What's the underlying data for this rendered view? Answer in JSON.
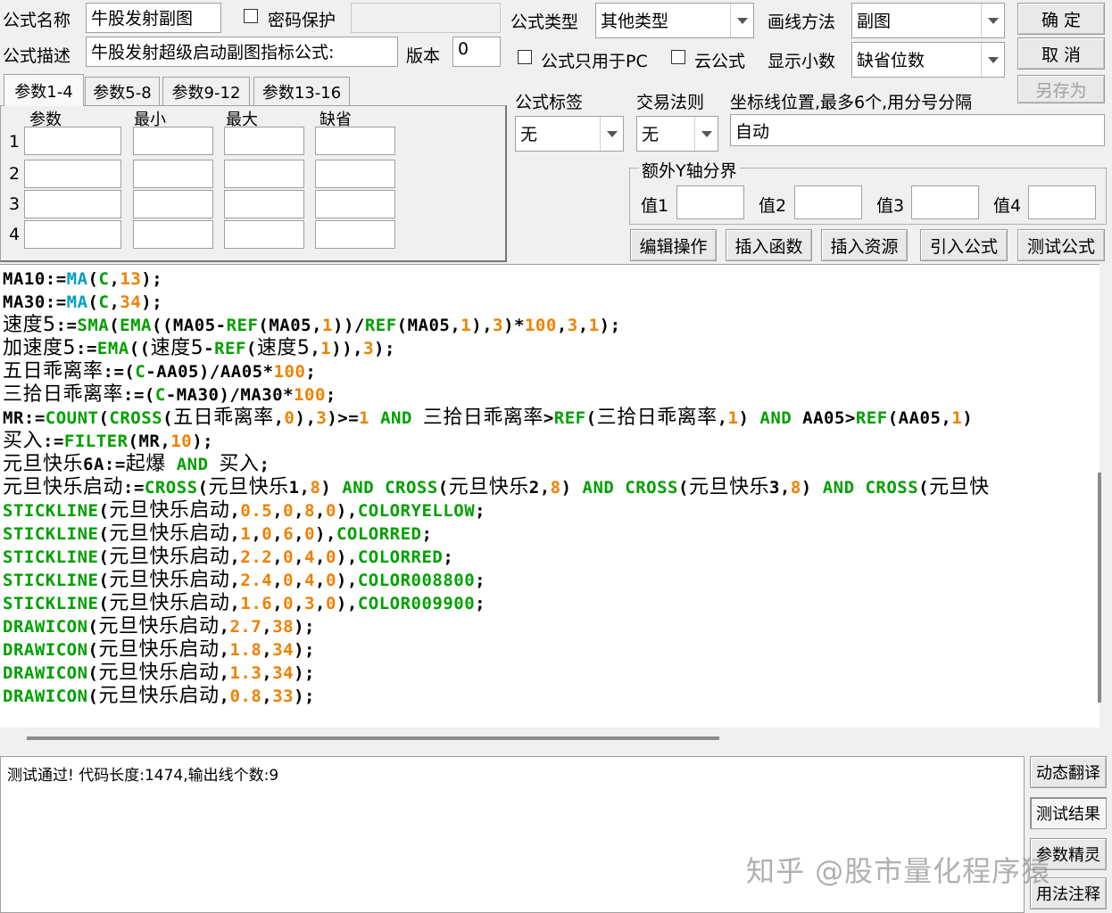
{
  "form": {
    "name_label": "公式名称",
    "name_value": "牛股发射副图",
    "password_label": "密码保护",
    "desc_label": "公式描述",
    "desc_value": "牛股发射超级启动副图指标公式:",
    "version_label": "版本",
    "version_value": "0",
    "type_label": "公式类型",
    "type_value": "其他类型",
    "draw_label": "画线方法",
    "draw_value": "副图",
    "pc_only_label": "公式只用于PC",
    "cloud_label": "云公式",
    "decimals_label": "显示小数",
    "decimals_value": "缺省位数",
    "tag_label": "公式标签",
    "tag_value": "无",
    "rule_label": "交易法则",
    "rule_value": "无",
    "axis_label": "坐标线位置,最多6个,用分号分隔",
    "axis_value": "自动",
    "yaxis_group": "额外Y轴分界",
    "yaxis_values": [
      "值1",
      "值2",
      "值3",
      "值4"
    ]
  },
  "buttons": {
    "ok": "确 定",
    "cancel": "取 消",
    "save_as": "另存为",
    "edit": "编辑操作",
    "insert_func": "插入函数",
    "insert_res": "插入资源",
    "import": "引入公式",
    "test": "测试公式",
    "dyn_translate": "动态翻译",
    "test_result": "测试结果",
    "param_wizard": "参数精灵",
    "usage_notes": "用法注释"
  },
  "tabs": [
    "参数1-4",
    "参数5-8",
    "参数9-12",
    "参数13-16"
  ],
  "params": {
    "headers": [
      "参数",
      "最小",
      "最大",
      "缺省"
    ],
    "rows": [
      "1",
      "2",
      "3",
      "4"
    ]
  },
  "colors": {
    "keyword": "#00a000",
    "number": "#f08000",
    "function": "#00a0c0",
    "plain": "#000000"
  },
  "code": [
    [
      [
        "MA10:=",
        "p"
      ],
      [
        "MA",
        "f"
      ],
      [
        "(",
        "p"
      ],
      [
        "C",
        "k"
      ],
      [
        ",",
        "p"
      ],
      [
        "13",
        "n"
      ],
      [
        ");",
        "p"
      ]
    ],
    [
      [
        "MA30:=",
        "p"
      ],
      [
        "MA",
        "f"
      ],
      [
        "(",
        "p"
      ],
      [
        "C",
        "k"
      ],
      [
        ",",
        "p"
      ],
      [
        "34",
        "n"
      ],
      [
        ");",
        "p"
      ]
    ],
    [
      [
        "速度5",
        "c"
      ],
      [
        ":=",
        "p"
      ],
      [
        "SMA",
        "k"
      ],
      [
        "(",
        "p"
      ],
      [
        "EMA",
        "k"
      ],
      [
        "((MA05-",
        "p"
      ],
      [
        "REF",
        "k"
      ],
      [
        "(MA05,",
        "p"
      ],
      [
        "1",
        "n"
      ],
      [
        "))/",
        "p"
      ],
      [
        "REF",
        "k"
      ],
      [
        "(MA05,",
        "p"
      ],
      [
        "1",
        "n"
      ],
      [
        "),",
        "p"
      ],
      [
        "3",
        "n"
      ],
      [
        ")*",
        "p"
      ],
      [
        "100",
        "n"
      ],
      [
        ",",
        "p"
      ],
      [
        "3",
        "n"
      ],
      [
        ",",
        "p"
      ],
      [
        "1",
        "n"
      ],
      [
        ");",
        "p"
      ]
    ],
    [
      [
        "加速度5",
        "c"
      ],
      [
        ":=",
        "p"
      ],
      [
        "EMA",
        "k"
      ],
      [
        "((",
        "p"
      ],
      [
        "速度5",
        "c"
      ],
      [
        "-",
        "p"
      ],
      [
        "REF",
        "k"
      ],
      [
        "(",
        "p"
      ],
      [
        "速度5",
        "c"
      ],
      [
        ",",
        "p"
      ],
      [
        "1",
        "n"
      ],
      [
        ")),",
        "p"
      ],
      [
        "3",
        "n"
      ],
      [
        ");",
        "p"
      ]
    ],
    [
      [
        "五日乖离率",
        "c"
      ],
      [
        ":=(",
        "p"
      ],
      [
        "C",
        "k"
      ],
      [
        "-AA05)/AA05*",
        "p"
      ],
      [
        "100",
        "n"
      ],
      [
        ";",
        "p"
      ]
    ],
    [
      [
        "三拾日乖离率",
        "c"
      ],
      [
        ":=(",
        "p"
      ],
      [
        "C",
        "k"
      ],
      [
        "-MA30)/MA30*",
        "p"
      ],
      [
        "100",
        "n"
      ],
      [
        ";",
        "p"
      ]
    ],
    [
      [
        "MR:=",
        "p"
      ],
      [
        "COUNT",
        "k"
      ],
      [
        "(",
        "p"
      ],
      [
        "CROSS",
        "k"
      ],
      [
        "(",
        "p"
      ],
      [
        "五日乖离率",
        "c"
      ],
      [
        ",",
        "p"
      ],
      [
        "0",
        "n"
      ],
      [
        "),",
        "p"
      ],
      [
        "3",
        "n"
      ],
      [
        ")>=",
        "p"
      ],
      [
        "1",
        "n"
      ],
      [
        " AND ",
        "k"
      ],
      [
        "三拾日乖离率",
        "c"
      ],
      [
        ">",
        "p"
      ],
      [
        "REF",
        "k"
      ],
      [
        "(",
        "p"
      ],
      [
        "三拾日乖离率",
        "c"
      ],
      [
        ",",
        "p"
      ],
      [
        "1",
        "n"
      ],
      [
        ") ",
        "p"
      ],
      [
        "AND",
        "k"
      ],
      [
        " AA05>",
        "p"
      ],
      [
        "REF",
        "k"
      ],
      [
        "(AA05,",
        "p"
      ],
      [
        "1",
        "n"
      ],
      [
        ")",
        "p"
      ]
    ],
    [
      [
        "买入",
        "c"
      ],
      [
        ":=",
        "p"
      ],
      [
        "FILTER",
        "k"
      ],
      [
        "(MR,",
        "p"
      ],
      [
        "10",
        "n"
      ],
      [
        ");",
        "p"
      ]
    ],
    [
      [
        "元旦快乐",
        "c"
      ],
      [
        "6A:=",
        "p"
      ],
      [
        "起爆",
        "c"
      ],
      [
        " AND ",
        "k"
      ],
      [
        "买入",
        "c"
      ],
      [
        ";",
        "p"
      ]
    ],
    [
      [
        "元旦快乐启动",
        "c"
      ],
      [
        ":=",
        "p"
      ],
      [
        "CROSS",
        "k"
      ],
      [
        "(",
        "p"
      ],
      [
        "元旦快乐",
        "c"
      ],
      [
        "1,",
        "p"
      ],
      [
        "8",
        "n"
      ],
      [
        ") ",
        "p"
      ],
      [
        "AND",
        "k"
      ],
      [
        " ",
        "p"
      ],
      [
        "CROSS",
        "k"
      ],
      [
        "(",
        "p"
      ],
      [
        "元旦快乐",
        "c"
      ],
      [
        "2,",
        "p"
      ],
      [
        "8",
        "n"
      ],
      [
        ") ",
        "p"
      ],
      [
        "AND",
        "k"
      ],
      [
        " ",
        "p"
      ],
      [
        "CROSS",
        "k"
      ],
      [
        "(",
        "p"
      ],
      [
        "元旦快乐",
        "c"
      ],
      [
        "3,",
        "p"
      ],
      [
        "8",
        "n"
      ],
      [
        ") ",
        "p"
      ],
      [
        "AND",
        "k"
      ],
      [
        " ",
        "p"
      ],
      [
        "CROSS",
        "k"
      ],
      [
        "(",
        "p"
      ],
      [
        "元旦快",
        "c"
      ]
    ],
    [
      [
        "STICKLINE",
        "k"
      ],
      [
        "(",
        "p"
      ],
      [
        "元旦快乐启动",
        "c"
      ],
      [
        ",",
        "p"
      ],
      [
        "0.5",
        "n"
      ],
      [
        ",",
        "p"
      ],
      [
        "0",
        "n"
      ],
      [
        ",",
        "p"
      ],
      [
        "8",
        "n"
      ],
      [
        ",",
        "p"
      ],
      [
        "0",
        "n"
      ],
      [
        "),",
        "p"
      ],
      [
        "COLORYELLOW",
        "k"
      ],
      [
        ";",
        "p"
      ]
    ],
    [
      [
        "STICKLINE",
        "k"
      ],
      [
        "(",
        "p"
      ],
      [
        "元旦快乐启动",
        "c"
      ],
      [
        ",",
        "p"
      ],
      [
        "1",
        "n"
      ],
      [
        ",",
        "p"
      ],
      [
        "0",
        "n"
      ],
      [
        ",",
        "p"
      ],
      [
        "6",
        "n"
      ],
      [
        ",",
        "p"
      ],
      [
        "0",
        "n"
      ],
      [
        "),",
        "p"
      ],
      [
        "COLORRED",
        "k"
      ],
      [
        ";",
        "p"
      ]
    ],
    [
      [
        "STICKLINE",
        "k"
      ],
      [
        "(",
        "p"
      ],
      [
        "元旦快乐启动",
        "c"
      ],
      [
        ",",
        "p"
      ],
      [
        "2.2",
        "n"
      ],
      [
        ",",
        "p"
      ],
      [
        "0",
        "n"
      ],
      [
        ",",
        "p"
      ],
      [
        "4",
        "n"
      ],
      [
        ",",
        "p"
      ],
      [
        "0",
        "n"
      ],
      [
        "),",
        "p"
      ],
      [
        "COLORRED",
        "k"
      ],
      [
        ";",
        "p"
      ]
    ],
    [
      [
        "STICKLINE",
        "k"
      ],
      [
        "(",
        "p"
      ],
      [
        "元旦快乐启动",
        "c"
      ],
      [
        ",",
        "p"
      ],
      [
        "2.4",
        "n"
      ],
      [
        ",",
        "p"
      ],
      [
        "0",
        "n"
      ],
      [
        ",",
        "p"
      ],
      [
        "4",
        "n"
      ],
      [
        ",",
        "p"
      ],
      [
        "0",
        "n"
      ],
      [
        "),",
        "p"
      ],
      [
        "COLOR008800",
        "k"
      ],
      [
        ";",
        "p"
      ]
    ],
    [
      [
        "STICKLINE",
        "k"
      ],
      [
        "(",
        "p"
      ],
      [
        "元旦快乐启动",
        "c"
      ],
      [
        ",",
        "p"
      ],
      [
        "1.6",
        "n"
      ],
      [
        ",",
        "p"
      ],
      [
        "0",
        "n"
      ],
      [
        ",",
        "p"
      ],
      [
        "3",
        "n"
      ],
      [
        ",",
        "p"
      ],
      [
        "0",
        "n"
      ],
      [
        "),",
        "p"
      ],
      [
        "COLOR009900",
        "k"
      ],
      [
        ";",
        "p"
      ]
    ],
    [
      [
        "DRAWICON",
        "k"
      ],
      [
        "(",
        "p"
      ],
      [
        "元旦快乐启动",
        "c"
      ],
      [
        ",",
        "p"
      ],
      [
        "2.7",
        "n"
      ],
      [
        ",",
        "p"
      ],
      [
        "38",
        "n"
      ],
      [
        ");",
        "p"
      ]
    ],
    [
      [
        "DRAWICON",
        "k"
      ],
      [
        "(",
        "p"
      ],
      [
        "元旦快乐启动",
        "c"
      ],
      [
        ",",
        "p"
      ],
      [
        "1.8",
        "n"
      ],
      [
        ",",
        "p"
      ],
      [
        "34",
        "n"
      ],
      [
        ");",
        "p"
      ]
    ],
    [
      [
        "DRAWICON",
        "k"
      ],
      [
        "(",
        "p"
      ],
      [
        "元旦快乐启动",
        "c"
      ],
      [
        ",",
        "p"
      ],
      [
        "1.3",
        "n"
      ],
      [
        ",",
        "p"
      ],
      [
        "34",
        "n"
      ],
      [
        ");",
        "p"
      ]
    ],
    [
      [
        "DRAWICON",
        "k"
      ],
      [
        "(",
        "p"
      ],
      [
        "元旦快乐启动",
        "c"
      ],
      [
        ",",
        "p"
      ],
      [
        "0.8",
        "n"
      ],
      [
        ",",
        "p"
      ],
      [
        "33",
        "n"
      ],
      [
        ");",
        "p"
      ]
    ]
  ],
  "output_text": "测试通过! 代码长度:1474,输出线个数:9",
  "watermark": "知乎 @股市量化程序猿"
}
